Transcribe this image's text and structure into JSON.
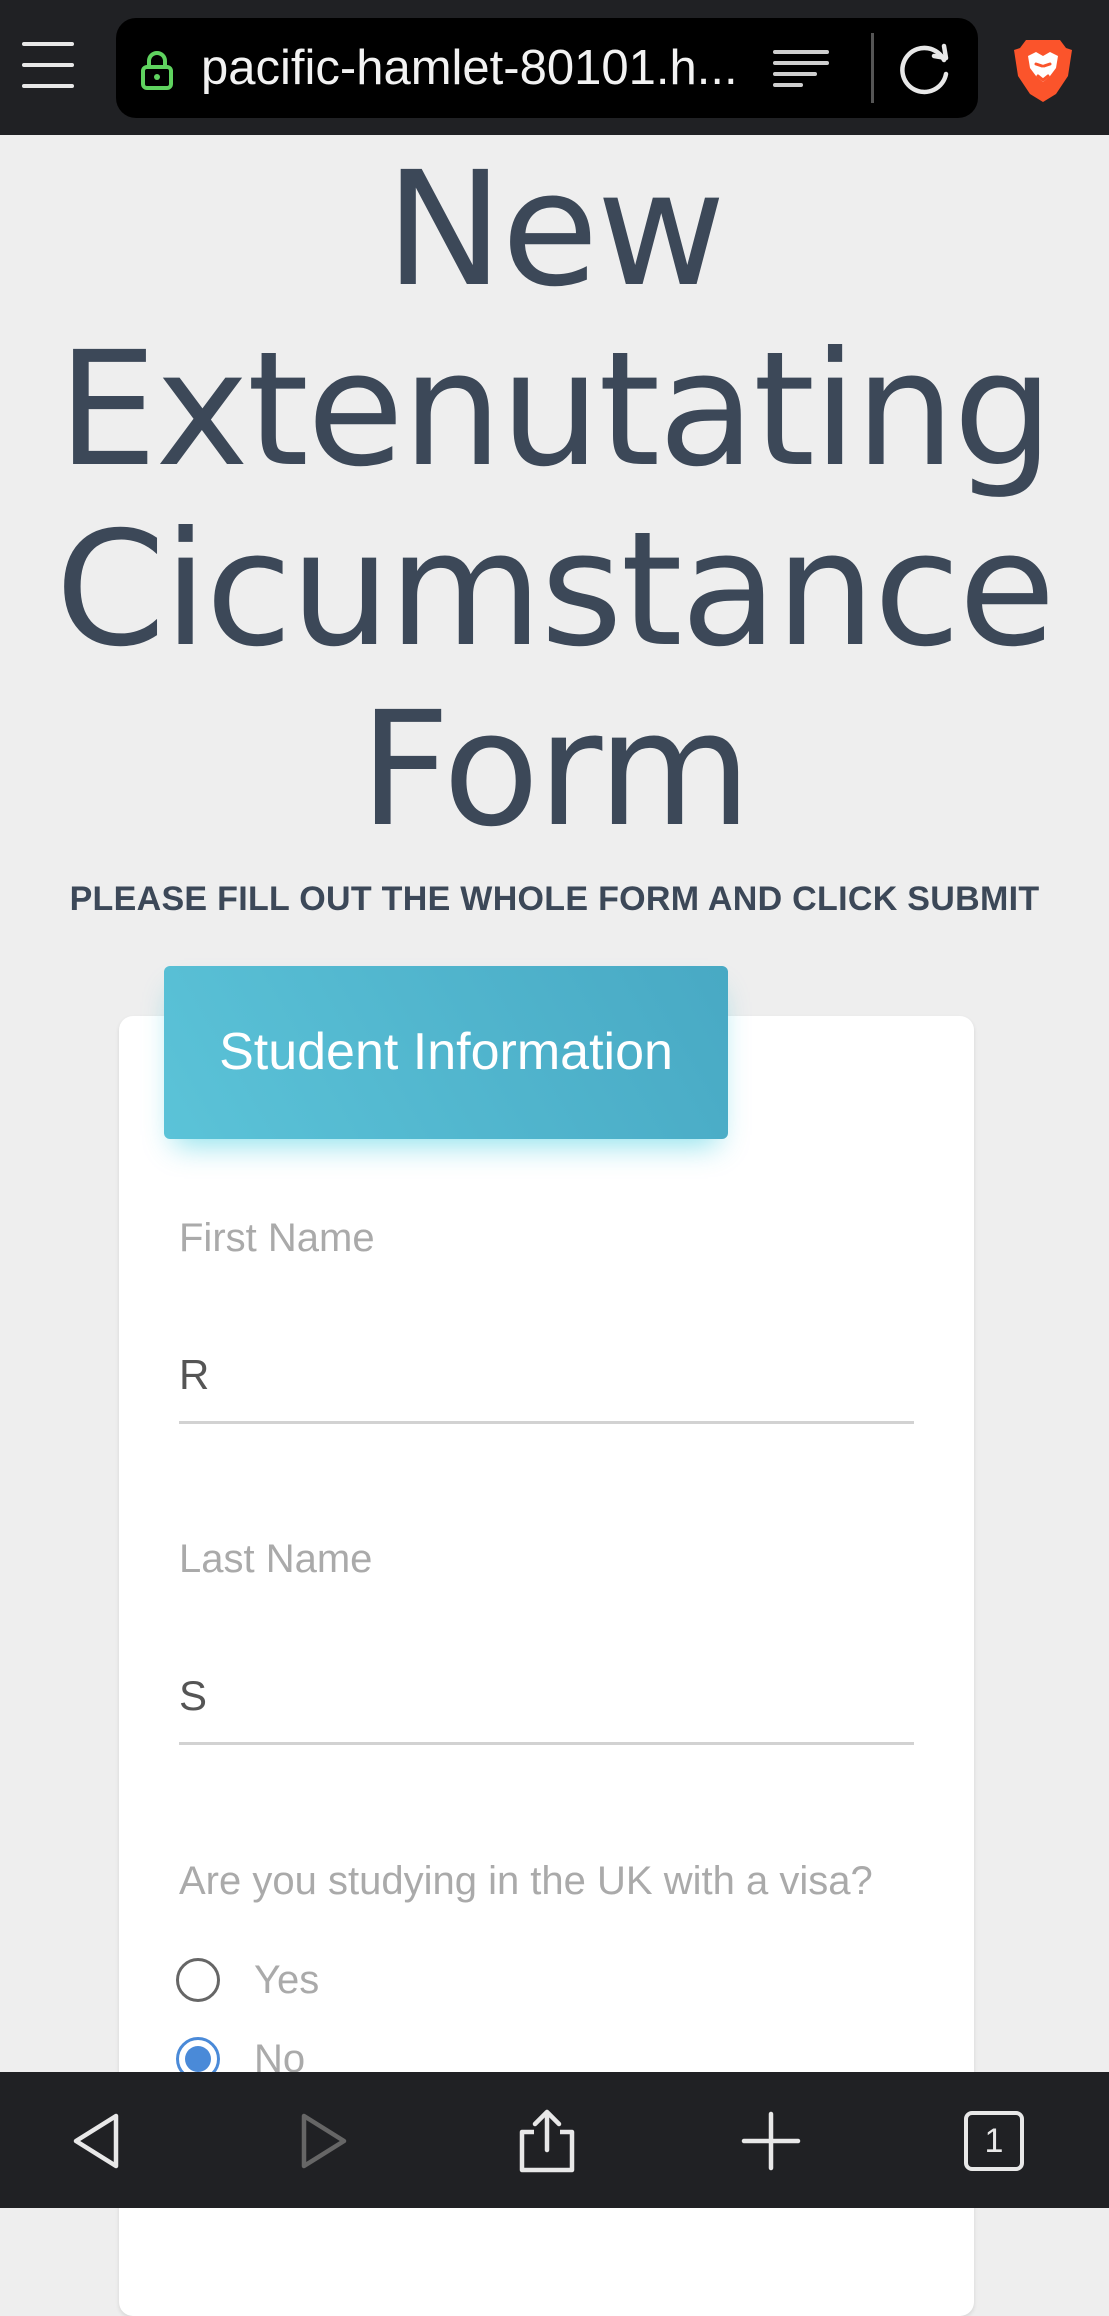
{
  "browser": {
    "url": "pacific-hamlet-80101.h...",
    "tab_count": "1",
    "icons": {
      "menu": "hamburger-menu-icon",
      "lock": "lock-icon",
      "reader": "reader-mode-icon",
      "reload": "reload-icon",
      "brave": "brave-lion-icon",
      "back": "back-icon",
      "forward": "forward-icon",
      "share": "share-icon",
      "new_tab": "new-tab-icon",
      "tabs": "tabs-icon"
    },
    "colors": {
      "lock": "#5fd35f",
      "brave": "#fb542b"
    }
  },
  "page": {
    "title_lines": [
      "New",
      "Extenutating",
      "Cicumstance",
      "Form"
    ],
    "subtitle": "PLEASE FILL OUT THE WHOLE FORM AND CLICK SUBMIT"
  },
  "form": {
    "section_title": "Student Information",
    "first_name": {
      "label": "First Name",
      "value": "R"
    },
    "last_name": {
      "label": "Last Name",
      "value": "S"
    },
    "visa_question": {
      "label": "Are you studying in the UK with a visa?",
      "options": [
        {
          "label": "Yes",
          "checked": false
        },
        {
          "label": "No",
          "checked": true
        }
      ]
    }
  },
  "colors": {
    "accent": "#4a8ad8",
    "header_gradient": [
      "#5bc3d8",
      "#48a9c4"
    ],
    "title_text": "#3c4858"
  }
}
